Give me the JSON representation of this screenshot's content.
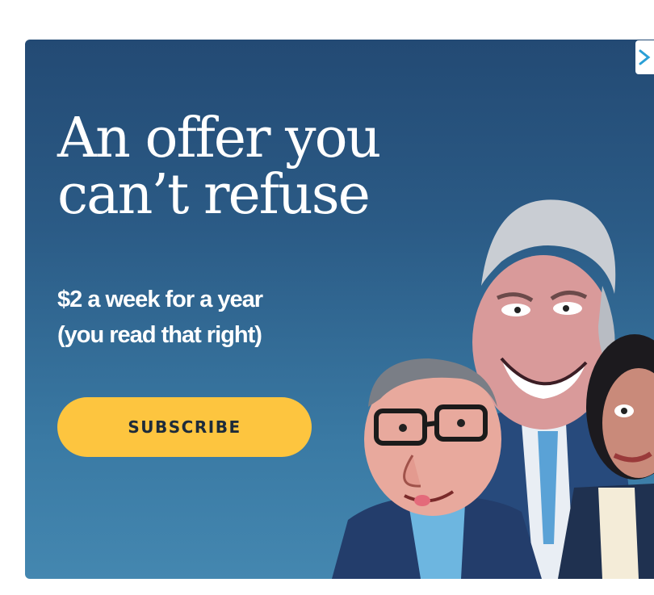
{
  "ad": {
    "headline_line1": "An offer you",
    "headline_line2": "can’t refuse",
    "subline_line1": "$2 a week for a year",
    "subline_line2": "(you read that right)",
    "button_label": "SUBSCRIBE",
    "close_icon": "close-x-icon"
  },
  "colors": {
    "background_top": "#234a74",
    "background_bottom": "#4487b0",
    "button": "#fdc53f",
    "close_accent": "#2a9fd6"
  }
}
